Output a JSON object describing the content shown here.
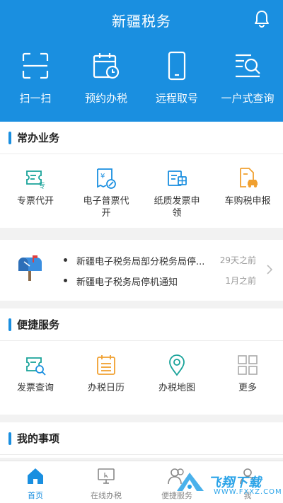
{
  "header": {
    "title": "新疆税务",
    "actions": [
      {
        "label": "扫一扫",
        "icon": "scan-icon"
      },
      {
        "label": "预约办税",
        "icon": "calendar-clock-icon"
      },
      {
        "label": "远程取号",
        "icon": "phone-icon"
      },
      {
        "label": "一户式查询",
        "icon": "search-list-icon"
      }
    ]
  },
  "common": {
    "title": "常办业务",
    "items": [
      {
        "label": "专票代开",
        "icon": "special-invoice-icon"
      },
      {
        "label": "电子普票代开",
        "icon": "e-invoice-icon"
      },
      {
        "label": "纸质发票申领",
        "icon": "paper-invoice-icon"
      },
      {
        "label": "车购税申报",
        "icon": "vehicle-tax-icon"
      }
    ]
  },
  "notices": [
    {
      "text": "新疆电子税务局部分税务局停...",
      "time": "29天之前"
    },
    {
      "text": "新疆电子税务局停机通知",
      "time": "1月之前"
    }
  ],
  "convenient": {
    "title": "便捷服务",
    "items": [
      {
        "label": "发票查询",
        "icon": "invoice-search-icon"
      },
      {
        "label": "办税日历",
        "icon": "tax-calendar-icon"
      },
      {
        "label": "办税地图",
        "icon": "map-pin-icon"
      },
      {
        "label": "更多",
        "icon": "more-grid-icon"
      }
    ]
  },
  "my_items": {
    "title": "我的事项"
  },
  "tabs": [
    {
      "label": "首页",
      "active": true
    },
    {
      "label": "在线办税",
      "active": false
    },
    {
      "label": "便捷服务",
      "active": false
    },
    {
      "label": "我",
      "active": false
    }
  ],
  "watermark": {
    "text": "飞翔下载",
    "url": "WWW.FXXZ.COM"
  },
  "colors": {
    "primary": "#1a8fe0",
    "teal": "#1aa39a",
    "orange": "#f0a030",
    "background": "#f2f2f2"
  }
}
